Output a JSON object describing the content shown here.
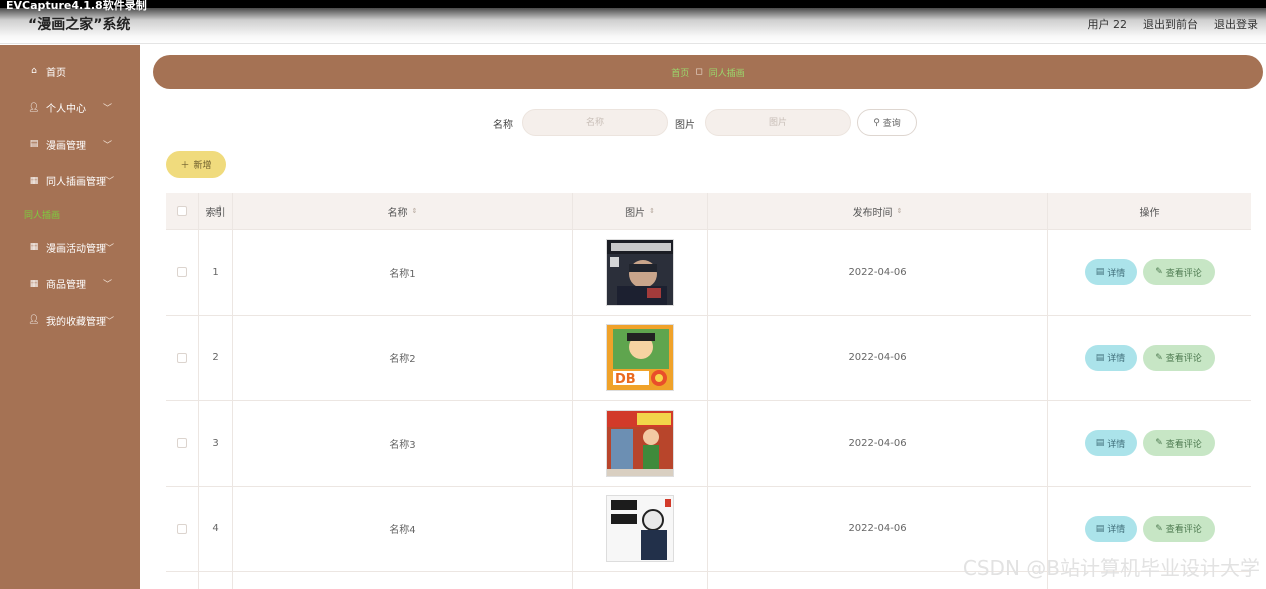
{
  "capture": {
    "text": "EVCapture4.1.8软件录制"
  },
  "header": {
    "title": "“漫画之家”系统",
    "user_label": "用户 22",
    "back_to_front": "退出到前台",
    "logout": "退出登录"
  },
  "sidebar": {
    "items": [
      {
        "label": "首页",
        "icon": "home-icon"
      },
      {
        "label": "个人中心",
        "icon": "user-icon"
      },
      {
        "label": "漫画管理",
        "icon": "book-icon"
      },
      {
        "label": "同人插画管理",
        "icon": "grid-icon"
      },
      {
        "label": "漫画活动管理",
        "icon": "grid-icon"
      },
      {
        "label": "商品管理",
        "icon": "grid-icon"
      },
      {
        "label": "我的收藏管理",
        "icon": "user-icon"
      }
    ],
    "active_sub": "同人插画"
  },
  "breadcrumb": {
    "home": "首页",
    "current": "同人插画"
  },
  "search": {
    "name_label": "名称",
    "name_placeholder": "名称",
    "image_label": "图片",
    "image_placeholder": "图片",
    "button": "查询"
  },
  "actions": {
    "add": "新增"
  },
  "table": {
    "headers": {
      "index": "索引",
      "name": "名称",
      "image": "图片",
      "time": "发布时间",
      "ops": "操作"
    },
    "rows": [
      {
        "index": "1",
        "name": "名称1",
        "time": "2022-04-06",
        "cover": "cover-1"
      },
      {
        "index": "2",
        "name": "名称2",
        "time": "2022-04-06",
        "cover": "cover-2"
      },
      {
        "index": "3",
        "name": "名称3",
        "time": "2022-04-06",
        "cover": "cover-3"
      },
      {
        "index": "4",
        "name": "名称4",
        "time": "2022-04-06",
        "cover": "cover-4"
      }
    ],
    "detail_label": "详情",
    "comment_label": "查看评论"
  },
  "watermark": "CSDN @B站计算机毕业设计大学",
  "colors": {
    "sidebar": "#a57254",
    "add_button": "#f0db7d",
    "detail_button": "#abe3ea",
    "comment_button": "#c7e6c5",
    "active_link": "#7ccf3e"
  }
}
